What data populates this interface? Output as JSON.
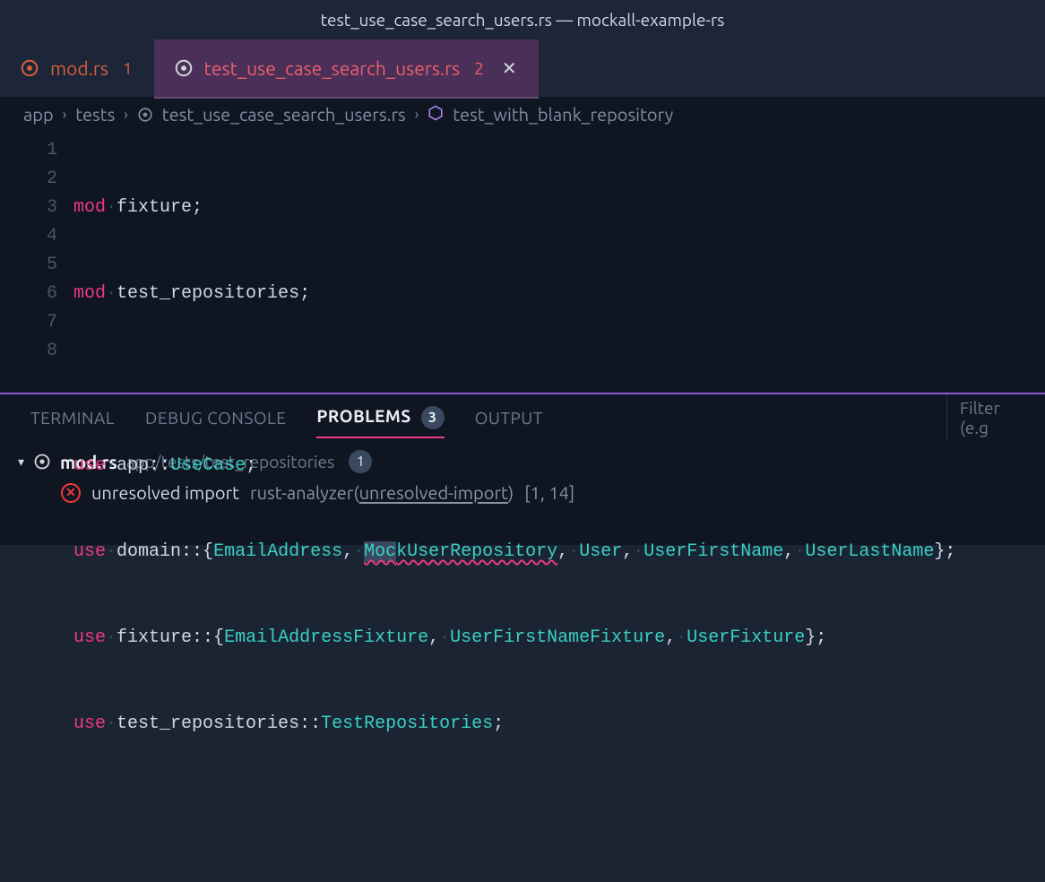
{
  "title": "test_use_case_search_users.rs — mockall-example-rs",
  "tabs": [
    {
      "name": "mod.rs",
      "count": "1"
    },
    {
      "name": "test_use_case_search_users.rs",
      "count": "2"
    }
  ],
  "breadcrumb": {
    "app": "app",
    "tests": "tests",
    "file": "test_use_case_search_users.rs",
    "fn": "test_with_blank_repository"
  },
  "editor": {
    "lines": {
      "l1": {
        "kw": "mod",
        "id": "fixture"
      },
      "l2": {
        "kw": "mod",
        "id": "test_repositories"
      },
      "l4": {
        "kw": "use",
        "path": "app",
        "item": "UseCase"
      },
      "l5": {
        "kw": "use",
        "path": "domain",
        "item1": "EmailAddress",
        "item2a": "Moc",
        "item2b": "kUserRepository",
        "item3": "User",
        "item4": "UserFirstName",
        "item5": "UserLastName"
      },
      "l6": {
        "kw": "use",
        "path": "fixture",
        "item1": "EmailAddressFixture",
        "item2": "UserFirstNameFixture",
        "item3": "UserFixture"
      },
      "l7": {
        "kw": "use",
        "path": "test_repositories",
        "item": "TestRepositories"
      }
    },
    "nums": [
      "1",
      "2",
      "3",
      "4",
      "5",
      "6",
      "7",
      "8"
    ],
    "dot": "·"
  },
  "panel": {
    "tabs": {
      "terminal": "TERMINAL",
      "debug": "DEBUG CONSOLE",
      "problems": "PROBLEMS",
      "problems_count": "3",
      "output": "OUTPUT"
    },
    "filter_placeholder": "Filter (e.g"
  },
  "problems": {
    "file": "mod.rs",
    "file_path": "app/tests/test_repositories",
    "file_count": "1",
    "msg": "unresolved import",
    "src_prefix": "rust-analyzer(",
    "src_code": "unresolved-import",
    "src_suffix": ")",
    "loc": "[1, 14]"
  }
}
